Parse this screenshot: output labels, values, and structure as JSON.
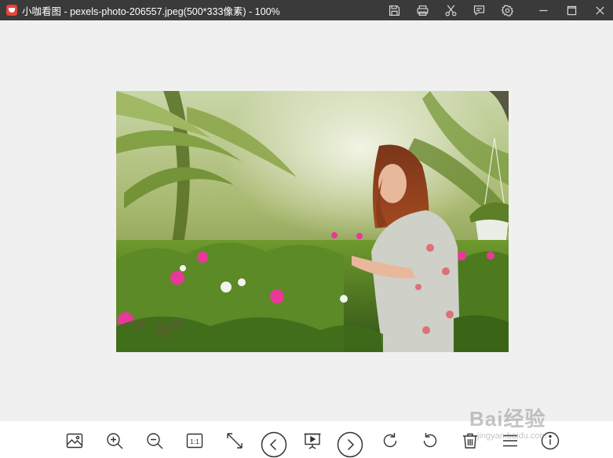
{
  "window": {
    "title": "小咖看图 - pexels-photo-206557.jpeg(500*333像素) - 100%"
  },
  "title_bar_buttons": [
    {
      "name": "save-icon"
    },
    {
      "name": "print-icon"
    },
    {
      "name": "scissors-icon"
    },
    {
      "name": "comment-icon"
    },
    {
      "name": "settings-gear-icon"
    },
    {
      "name": "minimize-icon"
    },
    {
      "name": "maximize-icon"
    },
    {
      "name": "close-icon"
    }
  ],
  "toolbar": {
    "actual_size_label": "1:1",
    "buttons": [
      "image-icon",
      "zoom-in-icon",
      "zoom-out-icon",
      "actual-size-icon",
      "fullscreen-icon",
      "previous-icon",
      "slideshow-icon",
      "next-icon",
      "rotate-clockwise-icon",
      "rotate-counterclockwise-icon",
      "delete-icon",
      "menu-icon",
      "info-icon"
    ]
  },
  "watermark": {
    "text": "Bai经验",
    "sub": "jingyan.baidu.com"
  },
  "colors": {
    "title_bar": "#3a3a3a",
    "viewer_background": "#f0f0f0",
    "toolbar_background": "#ffffff",
    "icon": "#333333"
  }
}
